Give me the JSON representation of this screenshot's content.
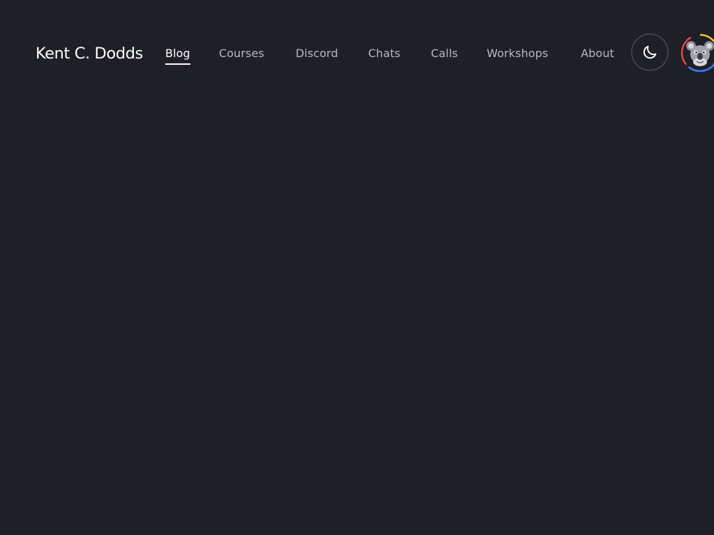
{
  "header": {
    "brand": "Kent C. Dodds",
    "nav": [
      {
        "label": "Blog",
        "active": true
      },
      {
        "label": "Courses",
        "active": false
      },
      {
        "label": "Discord",
        "active": false
      },
      {
        "label": "Chats",
        "active": false
      },
      {
        "label": "Calls",
        "active": false
      },
      {
        "label": "Workshops",
        "active": false
      },
      {
        "label": "About",
        "active": false
      }
    ],
    "theme_toggle_icon": "moon-icon",
    "avatar_icon": "koala-avatar-icon"
  },
  "colors": {
    "background": "#1f1f27",
    "nav_text": "#b7b8c0",
    "active_text": "#ffffff",
    "ring_red": "#ef4444",
    "ring_yellow": "#facc15",
    "ring_blue": "#3b82f6"
  }
}
